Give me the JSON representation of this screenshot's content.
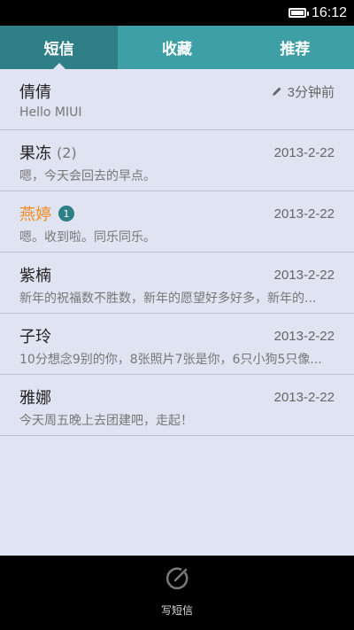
{
  "status": {
    "time": "16:12"
  },
  "tabs": [
    {
      "label": "短信",
      "active": true
    },
    {
      "label": "收藏",
      "active": false
    },
    {
      "label": "推荐",
      "active": false
    }
  ],
  "messages": [
    {
      "name": "倩倩",
      "count": "",
      "badge": "",
      "time": "3分钟前",
      "draft": true,
      "unread": false,
      "preview": "Hello MIUI"
    },
    {
      "name": "果冻",
      "count": "(2)",
      "badge": "",
      "time": "2013-2-22",
      "draft": false,
      "unread": false,
      "preview": "嗯，今天会回去的早点。"
    },
    {
      "name": "燕婷",
      "count": "",
      "badge": "1",
      "time": "2013-2-22",
      "draft": false,
      "unread": true,
      "preview": "嗯。收到啦。同乐同乐。"
    },
    {
      "name": "紫楠",
      "count": "",
      "badge": "",
      "time": "2013-2-22",
      "draft": false,
      "unread": false,
      "preview": "新年的祝福数不胜数，新年的愿望好多好多，新年的..."
    },
    {
      "name": "子玲",
      "count": "",
      "badge": "",
      "time": "2013-2-22",
      "draft": false,
      "unread": false,
      "preview": "10分想念9别的你，8张照片7张是你，6只小狗5只像..."
    },
    {
      "name": "雅娜",
      "count": "",
      "badge": "",
      "time": "2013-2-22",
      "draft": false,
      "unread": false,
      "preview": "今天周五晚上去团建吧，走起！"
    }
  ],
  "bottom": {
    "compose_label": "写短信"
  },
  "colors": {
    "accent": "#3ea0a6",
    "accent_dark": "#2f7f86",
    "list_bg": "#dfe3f2",
    "unread_name": "#f28a1c"
  }
}
